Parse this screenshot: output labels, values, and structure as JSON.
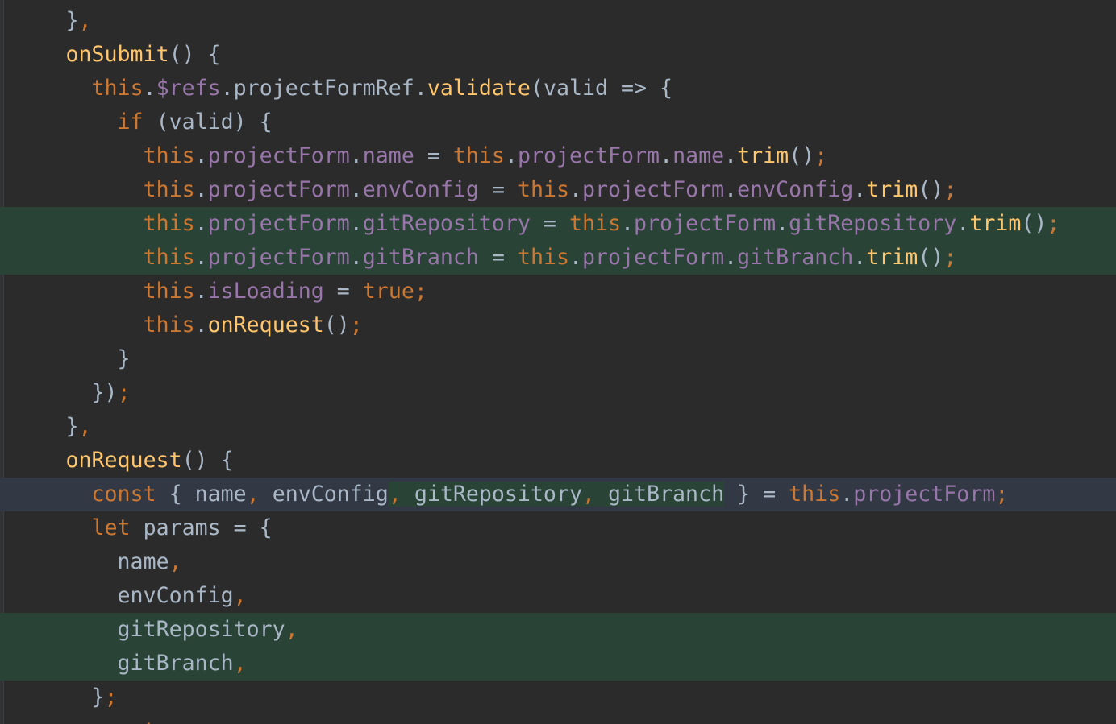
{
  "editor": {
    "language": "javascript",
    "colors": {
      "background": "#2b2b2b",
      "default_text": "#a9b7c6",
      "keyword": "#cc7832",
      "function_name": "#ffc66d",
      "property": "#9876aa",
      "added_line_background": "#294436",
      "caret_line_background": "#323844"
    },
    "lines": [
      {
        "indent": "",
        "tokens": [
          {
            "t": "}",
            "c": "punc"
          },
          {
            "t": ",",
            "c": "sep"
          }
        ]
      },
      {
        "indent": "",
        "tokens": [
          {
            "t": "onSubmit",
            "c": "fn"
          },
          {
            "t": "() {",
            "c": "punc"
          }
        ]
      },
      {
        "indent": "  ",
        "tokens": [
          {
            "t": "this",
            "c": "kw"
          },
          {
            "t": ".",
            "c": "punc"
          },
          {
            "t": "$refs",
            "c": "prop"
          },
          {
            "t": ".projectFormRef.",
            "c": "id"
          },
          {
            "t": "validate",
            "c": "fn"
          },
          {
            "t": "(valid => {",
            "c": "punc"
          }
        ]
      },
      {
        "indent": "    ",
        "tokens": [
          {
            "t": "if",
            "c": "kw"
          },
          {
            "t": " (valid) {",
            "c": "punc"
          }
        ]
      },
      {
        "indent": "      ",
        "tokens": [
          {
            "t": "this",
            "c": "kw"
          },
          {
            "t": ".",
            "c": "punc"
          },
          {
            "t": "projectForm",
            "c": "prop"
          },
          {
            "t": ".",
            "c": "punc"
          },
          {
            "t": "name",
            "c": "prop"
          },
          {
            "t": " = ",
            "c": "punc"
          },
          {
            "t": "this",
            "c": "kw"
          },
          {
            "t": ".",
            "c": "punc"
          },
          {
            "t": "projectForm",
            "c": "prop"
          },
          {
            "t": ".",
            "c": "punc"
          },
          {
            "t": "name",
            "c": "prop"
          },
          {
            "t": ".",
            "c": "punc"
          },
          {
            "t": "trim",
            "c": "fn"
          },
          {
            "t": "()",
            "c": "punc"
          },
          {
            "t": ";",
            "c": "sep"
          }
        ]
      },
      {
        "indent": "      ",
        "tokens": [
          {
            "t": "this",
            "c": "kw"
          },
          {
            "t": ".",
            "c": "punc"
          },
          {
            "t": "projectForm",
            "c": "prop"
          },
          {
            "t": ".",
            "c": "punc"
          },
          {
            "t": "envConfig",
            "c": "prop"
          },
          {
            "t": " = ",
            "c": "punc"
          },
          {
            "t": "this",
            "c": "kw"
          },
          {
            "t": ".",
            "c": "punc"
          },
          {
            "t": "projectForm",
            "c": "prop"
          },
          {
            "t": ".",
            "c": "punc"
          },
          {
            "t": "envConfig",
            "c": "prop"
          },
          {
            "t": ".",
            "c": "punc"
          },
          {
            "t": "trim",
            "c": "fn"
          },
          {
            "t": "()",
            "c": "punc"
          },
          {
            "t": ";",
            "c": "sep"
          }
        ]
      },
      {
        "indent": "      ",
        "added": true,
        "tokens": [
          {
            "t": "this",
            "c": "kw"
          },
          {
            "t": ".",
            "c": "punc"
          },
          {
            "t": "projectForm",
            "c": "prop"
          },
          {
            "t": ".",
            "c": "punc"
          },
          {
            "t": "gitRepository",
            "c": "prop"
          },
          {
            "t": " = ",
            "c": "punc"
          },
          {
            "t": "this",
            "c": "kw"
          },
          {
            "t": ".",
            "c": "punc"
          },
          {
            "t": "projectForm",
            "c": "prop"
          },
          {
            "t": ".",
            "c": "punc"
          },
          {
            "t": "gitRepository",
            "c": "prop"
          },
          {
            "t": ".",
            "c": "punc"
          },
          {
            "t": "trim",
            "c": "fn"
          },
          {
            "t": "()",
            "c": "punc"
          },
          {
            "t": ";",
            "c": "sep"
          }
        ]
      },
      {
        "indent": "      ",
        "added": true,
        "tokens": [
          {
            "t": "this",
            "c": "kw"
          },
          {
            "t": ".",
            "c": "punc"
          },
          {
            "t": "projectForm",
            "c": "prop"
          },
          {
            "t": ".",
            "c": "punc"
          },
          {
            "t": "gitBranch",
            "c": "prop"
          },
          {
            "t": " = ",
            "c": "punc"
          },
          {
            "t": "this",
            "c": "kw"
          },
          {
            "t": ".",
            "c": "punc"
          },
          {
            "t": "projectForm",
            "c": "prop"
          },
          {
            "t": ".",
            "c": "punc"
          },
          {
            "t": "gitBranch",
            "c": "prop"
          },
          {
            "t": ".",
            "c": "punc"
          },
          {
            "t": "trim",
            "c": "fn"
          },
          {
            "t": "()",
            "c": "punc"
          },
          {
            "t": ";",
            "c": "sep"
          }
        ]
      },
      {
        "indent": "      ",
        "tokens": [
          {
            "t": "this",
            "c": "kw"
          },
          {
            "t": ".",
            "c": "punc"
          },
          {
            "t": "isLoading",
            "c": "prop"
          },
          {
            "t": " = ",
            "c": "punc"
          },
          {
            "t": "true",
            "c": "kw"
          },
          {
            "t": ";",
            "c": "sep"
          }
        ]
      },
      {
        "indent": "      ",
        "tokens": [
          {
            "t": "this",
            "c": "kw"
          },
          {
            "t": ".",
            "c": "punc"
          },
          {
            "t": "onRequest",
            "c": "fn"
          },
          {
            "t": "()",
            "c": "punc"
          },
          {
            "t": ";",
            "c": "sep"
          }
        ]
      },
      {
        "indent": "    ",
        "tokens": [
          {
            "t": "}",
            "c": "punc"
          }
        ]
      },
      {
        "indent": "  ",
        "tokens": [
          {
            "t": "})",
            "c": "punc"
          },
          {
            "t": ";",
            "c": "sep"
          }
        ]
      },
      {
        "indent": "",
        "tokens": [
          {
            "t": "}",
            "c": "punc"
          },
          {
            "t": ",",
            "c": "sep"
          }
        ]
      },
      {
        "indent": "",
        "tokens": [
          {
            "t": "onRequest",
            "c": "fn"
          },
          {
            "t": "() {",
            "c": "punc"
          }
        ]
      },
      {
        "indent": "  ",
        "caret": true,
        "tokens": [
          {
            "t": "const",
            "c": "kw"
          },
          {
            "t": " { name",
            "c": "id"
          },
          {
            "t": ",",
            "c": "sep"
          },
          {
            "t": " envConfig",
            "c": "id"
          },
          {
            "t": ",",
            "c": "sep",
            "hl": true
          },
          {
            "t": " gitRepository",
            "c": "id",
            "hl": true
          },
          {
            "t": ",",
            "c": "sep",
            "hl": true
          },
          {
            "t": " gitBranch",
            "c": "id",
            "hl": true
          },
          {
            "t": " } = ",
            "c": "punc"
          },
          {
            "t": "this",
            "c": "kw"
          },
          {
            "t": ".",
            "c": "punc"
          },
          {
            "t": "projectForm",
            "c": "prop"
          },
          {
            "t": ";",
            "c": "sep"
          }
        ]
      },
      {
        "indent": "  ",
        "tokens": [
          {
            "t": "let",
            "c": "kw"
          },
          {
            "t": " params = {",
            "c": "id"
          }
        ]
      },
      {
        "indent": "    ",
        "tokens": [
          {
            "t": "name",
            "c": "id"
          },
          {
            "t": ",",
            "c": "sep"
          }
        ]
      },
      {
        "indent": "    ",
        "tokens": [
          {
            "t": "envConfig",
            "c": "id"
          },
          {
            "t": ",",
            "c": "sep"
          }
        ]
      },
      {
        "indent": "    ",
        "added": true,
        "tokens": [
          {
            "t": "gitRepository",
            "c": "id"
          },
          {
            "t": ",",
            "c": "sep"
          }
        ]
      },
      {
        "indent": "    ",
        "added": true,
        "tokens": [
          {
            "t": "gitBranch",
            "c": "id"
          },
          {
            "t": ",",
            "c": "sep"
          }
        ]
      },
      {
        "indent": "  ",
        "tokens": [
          {
            "t": "}",
            "c": "punc"
          },
          {
            "t": ";",
            "c": "sep"
          }
        ]
      },
      {
        "indent": "  ",
        "tokens": [
          {
            "t": "const",
            "c": "kw"
          }
        ]
      }
    ]
  }
}
